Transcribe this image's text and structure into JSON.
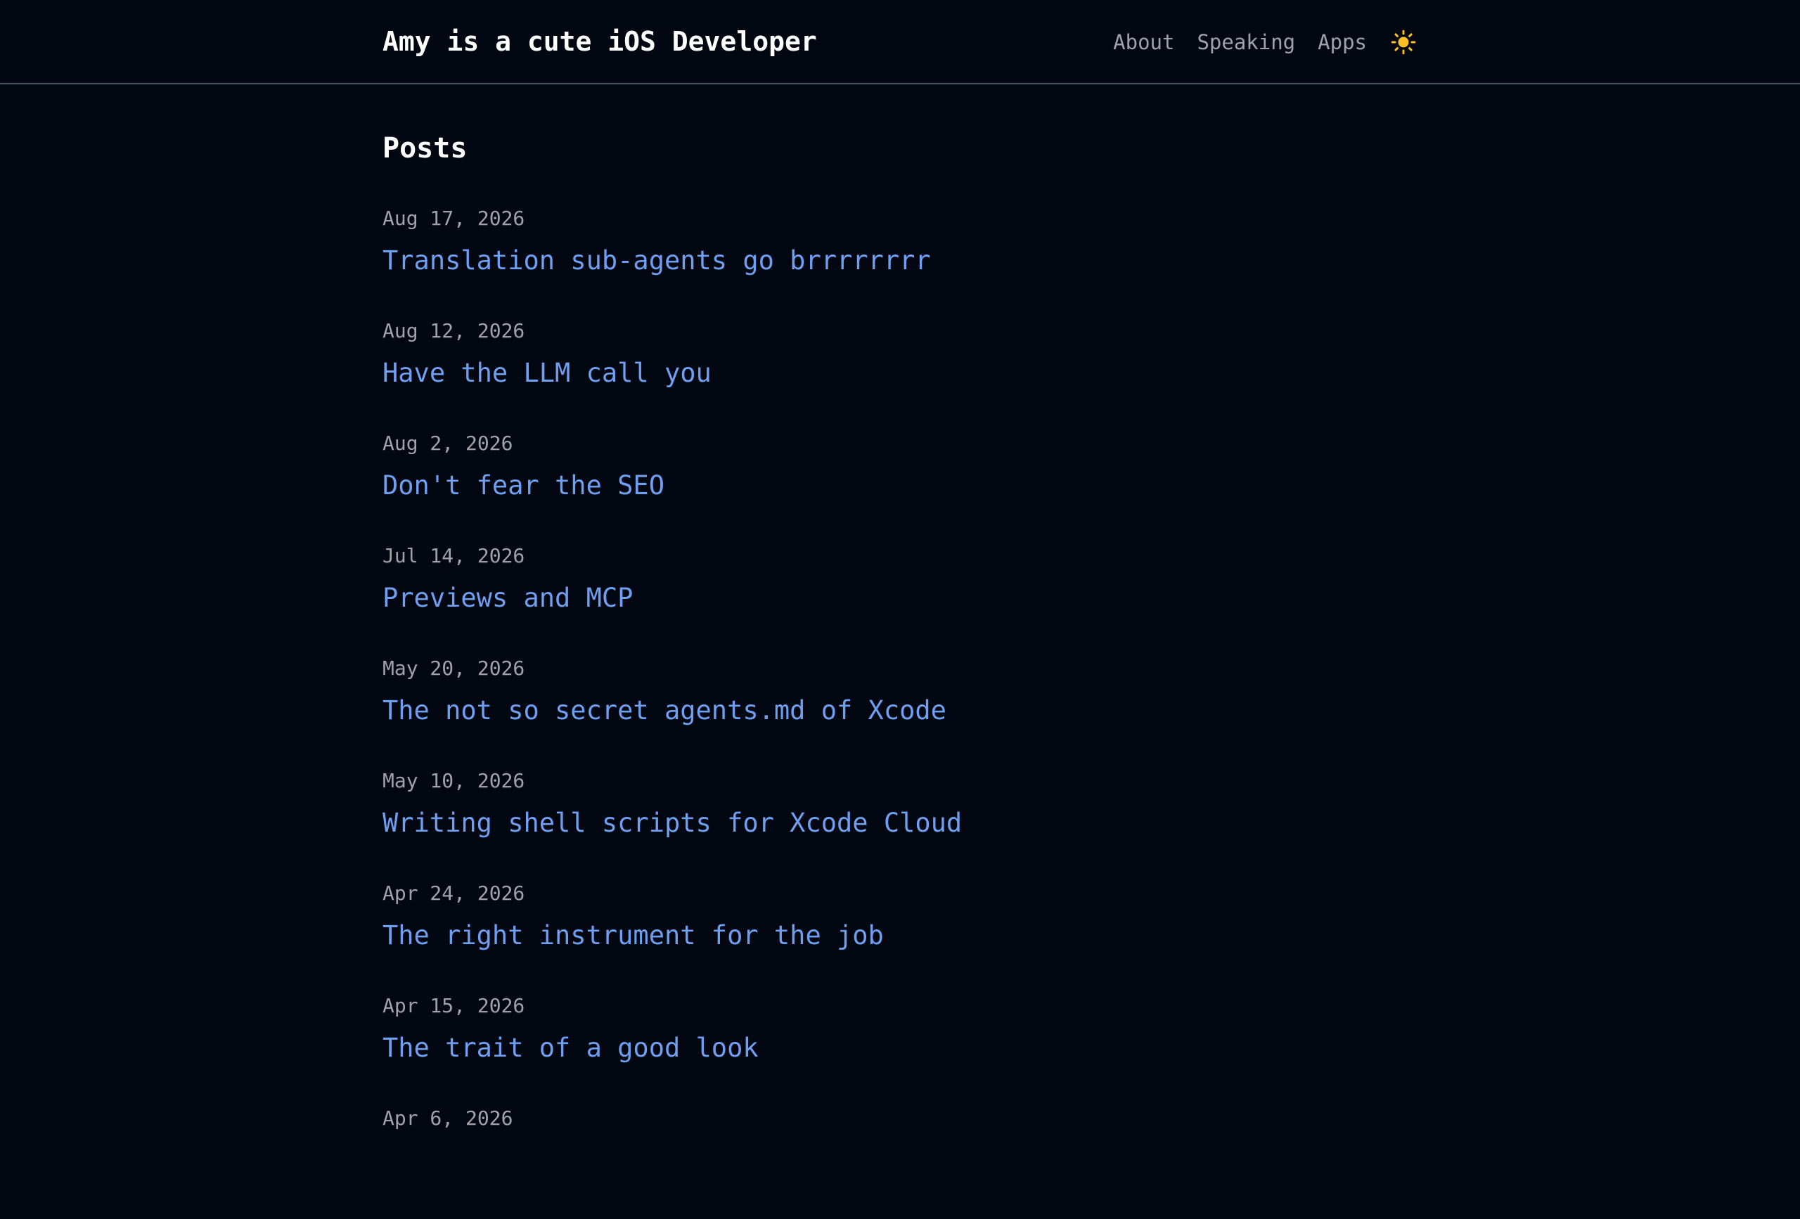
{
  "header": {
    "site_title": "Amy is a cute iOS Developer",
    "nav": [
      {
        "label": "About"
      },
      {
        "label": "Speaking"
      },
      {
        "label": "Apps"
      }
    ],
    "theme_icon": "sun-icon",
    "theme_icon_color": "#fbbf24"
  },
  "main": {
    "heading": "Posts",
    "posts": [
      {
        "date": "Aug 17, 2026",
        "title": "Translation sub-agents go brrrrrrrr"
      },
      {
        "date": "Aug 12, 2026",
        "title": "Have the LLM call you"
      },
      {
        "date": "Aug 2, 2026",
        "title": "Don't fear the SEO"
      },
      {
        "date": "Jul 14, 2026",
        "title": "Previews and MCP"
      },
      {
        "date": "May 20, 2026",
        "title": "The not so secret agents.md of Xcode"
      },
      {
        "date": "May 10, 2026",
        "title": "Writing shell scripts for Xcode Cloud"
      },
      {
        "date": "Apr 24, 2026",
        "title": "The right instrument for the job"
      },
      {
        "date": "Apr 15, 2026",
        "title": "The trait of a good look"
      },
      {
        "date": "Apr 6, 2026",
        "title": ""
      }
    ]
  },
  "colors": {
    "background": "#030712",
    "link": "#6f9ff0",
    "date": "#a1a1aa",
    "nav": "#9ca3af"
  }
}
